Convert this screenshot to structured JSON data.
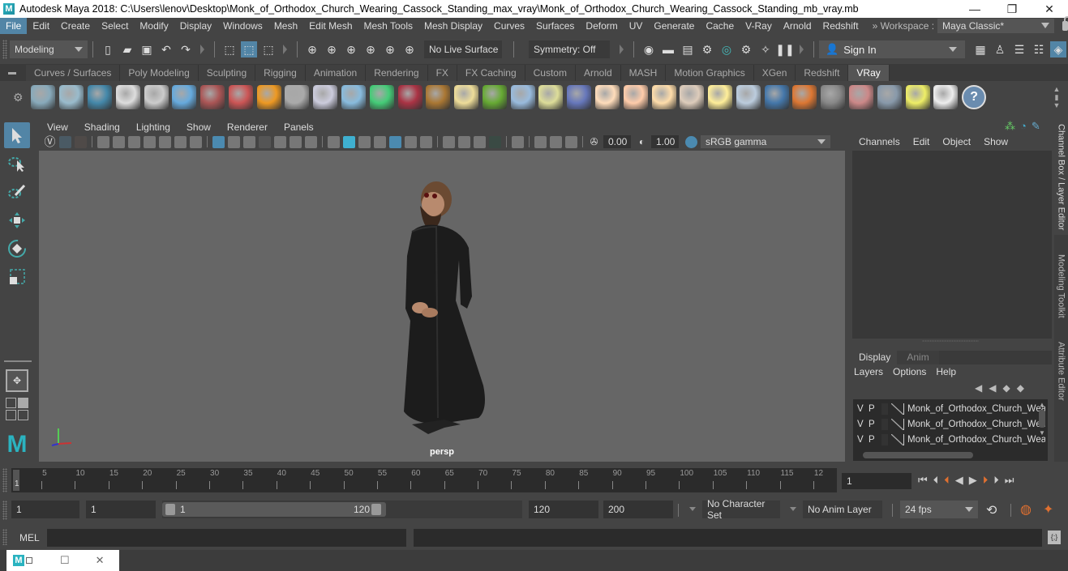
{
  "window": {
    "title": "Autodesk Maya 2018: C:\\Users\\lenov\\Desktop\\Monk_of_Orthodox_Church_Wearing_Cassock_Standing_max_vray\\Monk_of_Orthodox_Church_Wearing_Cassock_Standing_mb_vray.mb",
    "logo": "M",
    "minimize": "—",
    "restore": "❐",
    "close": "✕"
  },
  "menubar": {
    "items": [
      "File",
      "Edit",
      "Create",
      "Select",
      "Modify",
      "Display",
      "Windows",
      "Mesh",
      "Edit Mesh",
      "Mesh Tools",
      "Mesh Display",
      "Curves",
      "Surfaces",
      "Deform",
      "UV",
      "Generate",
      "Cache",
      "V-Ray",
      "Arnold",
      "Redshift"
    ],
    "active": "File",
    "workspace_label": "» Workspace :",
    "workspace_value": "Maya Classic*"
  },
  "statusline": {
    "mode": "Modeling",
    "live_surface": "No Live Surface",
    "symmetry": "Symmetry: Off",
    "sign_in": "Sign In"
  },
  "shelf": {
    "tabs": [
      "Curves / Surfaces",
      "Poly Modeling",
      "Sculpting",
      "Rigging",
      "Animation",
      "Rendering",
      "FX",
      "FX Caching",
      "Custom",
      "Arnold",
      "MASH",
      "Motion Graphics",
      "XGen",
      "Redshift",
      "VRay"
    ],
    "active_tab": "VRay",
    "icons": [
      "vray-export-icon",
      "vray-proxy-icon",
      "vray-render-elements-icon",
      "vray-logo-icon",
      "vray-file-icon",
      "vray-sphere-icon",
      "vray-camera-icon",
      "vray-mtl-icon",
      "vray-fire-icon",
      "vray-plane-icon",
      "vray-box-icon",
      "vray-cone-icon",
      "vray-light-icon",
      "vray-hair-icon",
      "vray-texture-icon",
      "vray-grid-sphere-icon",
      "vray-fur-icon",
      "vray-cluster-icon",
      "vray-curve-icon",
      "vray-mesh-sphere-icon",
      "vray-dome-light-icon",
      "vray-spot-light-icon",
      "vray-omni-light-icon",
      "vray-ies-light-icon",
      "vray-sun-icon",
      "vray-plane-light-icon",
      "vray-sphere-mtl-icon",
      "vray-blend-mtl-icon",
      "vray-checker-icon",
      "vray-frame-buffer-icon",
      "vray-settings-icon",
      "vray-light-lister-icon",
      "vray-cloud-icon",
      "help-icon"
    ]
  },
  "viewport": {
    "menus": [
      "View",
      "Shading",
      "Lighting",
      "Show",
      "Renderer",
      "Panels"
    ],
    "exposure": "0.00",
    "gamma": "1.00",
    "color_space": "sRGB gamma",
    "camera_label": "persp"
  },
  "channel_box": {
    "menus": [
      "Channels",
      "Edit",
      "Object",
      "Show"
    ]
  },
  "layer_editor": {
    "tabs": [
      "Display",
      "Anim"
    ],
    "active_tab": "Display",
    "menus": [
      "Layers",
      "Options",
      "Help"
    ],
    "layers": [
      {
        "v": "V",
        "p": "P",
        "name": "Monk_of_Orthodox_Church_Wear"
      },
      {
        "v": "V",
        "p": "P",
        "name": "Monk_of_Orthodox_Church_Wear"
      },
      {
        "v": "V",
        "p": "P",
        "name": "Monk_of_Orthodox_Church_Wear"
      }
    ]
  },
  "side_tabs": [
    "Channel Box / Layer Editor",
    "Modeling Toolkit",
    "Attribute Editor"
  ],
  "timeline": {
    "ticks": [
      "5",
      "10",
      "15",
      "20",
      "25",
      "30",
      "35",
      "40",
      "45",
      "50",
      "55",
      "60",
      "65",
      "70",
      "75",
      "80",
      "85",
      "90",
      "95",
      "100",
      "105",
      "110",
      "115",
      "12"
    ],
    "current_marker": "1",
    "current_frame": "1"
  },
  "range": {
    "start": "1",
    "playback_start": "1",
    "slider_start": "1",
    "slider_end": "120",
    "playback_end": "120",
    "end": "200",
    "character_set": "No Character Set",
    "anim_layer": "No Anim Layer",
    "fps": "24 fps"
  },
  "command_line": {
    "label": "MEL"
  },
  "mini_window": {
    "restore": "☐",
    "close": "✕"
  }
}
